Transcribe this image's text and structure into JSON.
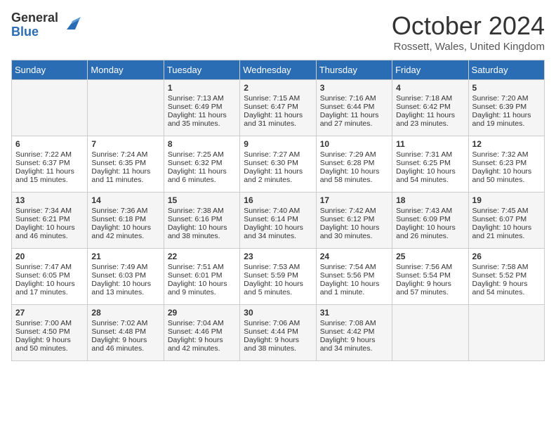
{
  "logo": {
    "general": "General",
    "blue": "Blue"
  },
  "title": "October 2024",
  "subtitle": "Rossett, Wales, United Kingdom",
  "days": [
    "Sunday",
    "Monday",
    "Tuesday",
    "Wednesday",
    "Thursday",
    "Friday",
    "Saturday"
  ],
  "weeks": [
    [
      {
        "day": "",
        "content": ""
      },
      {
        "day": "",
        "content": ""
      },
      {
        "day": "1",
        "content": "Sunrise: 7:13 AM\nSunset: 6:49 PM\nDaylight: 11 hours and 35 minutes."
      },
      {
        "day": "2",
        "content": "Sunrise: 7:15 AM\nSunset: 6:47 PM\nDaylight: 11 hours and 31 minutes."
      },
      {
        "day": "3",
        "content": "Sunrise: 7:16 AM\nSunset: 6:44 PM\nDaylight: 11 hours and 27 minutes."
      },
      {
        "day": "4",
        "content": "Sunrise: 7:18 AM\nSunset: 6:42 PM\nDaylight: 11 hours and 23 minutes."
      },
      {
        "day": "5",
        "content": "Sunrise: 7:20 AM\nSunset: 6:39 PM\nDaylight: 11 hours and 19 minutes."
      }
    ],
    [
      {
        "day": "6",
        "content": "Sunrise: 7:22 AM\nSunset: 6:37 PM\nDaylight: 11 hours and 15 minutes."
      },
      {
        "day": "7",
        "content": "Sunrise: 7:24 AM\nSunset: 6:35 PM\nDaylight: 11 hours and 11 minutes."
      },
      {
        "day": "8",
        "content": "Sunrise: 7:25 AM\nSunset: 6:32 PM\nDaylight: 11 hours and 6 minutes."
      },
      {
        "day": "9",
        "content": "Sunrise: 7:27 AM\nSunset: 6:30 PM\nDaylight: 11 hours and 2 minutes."
      },
      {
        "day": "10",
        "content": "Sunrise: 7:29 AM\nSunset: 6:28 PM\nDaylight: 10 hours and 58 minutes."
      },
      {
        "day": "11",
        "content": "Sunrise: 7:31 AM\nSunset: 6:25 PM\nDaylight: 10 hours and 54 minutes."
      },
      {
        "day": "12",
        "content": "Sunrise: 7:32 AM\nSunset: 6:23 PM\nDaylight: 10 hours and 50 minutes."
      }
    ],
    [
      {
        "day": "13",
        "content": "Sunrise: 7:34 AM\nSunset: 6:21 PM\nDaylight: 10 hours and 46 minutes."
      },
      {
        "day": "14",
        "content": "Sunrise: 7:36 AM\nSunset: 6:18 PM\nDaylight: 10 hours and 42 minutes."
      },
      {
        "day": "15",
        "content": "Sunrise: 7:38 AM\nSunset: 6:16 PM\nDaylight: 10 hours and 38 minutes."
      },
      {
        "day": "16",
        "content": "Sunrise: 7:40 AM\nSunset: 6:14 PM\nDaylight: 10 hours and 34 minutes."
      },
      {
        "day": "17",
        "content": "Sunrise: 7:42 AM\nSunset: 6:12 PM\nDaylight: 10 hours and 30 minutes."
      },
      {
        "day": "18",
        "content": "Sunrise: 7:43 AM\nSunset: 6:09 PM\nDaylight: 10 hours and 26 minutes."
      },
      {
        "day": "19",
        "content": "Sunrise: 7:45 AM\nSunset: 6:07 PM\nDaylight: 10 hours and 21 minutes."
      }
    ],
    [
      {
        "day": "20",
        "content": "Sunrise: 7:47 AM\nSunset: 6:05 PM\nDaylight: 10 hours and 17 minutes."
      },
      {
        "day": "21",
        "content": "Sunrise: 7:49 AM\nSunset: 6:03 PM\nDaylight: 10 hours and 13 minutes."
      },
      {
        "day": "22",
        "content": "Sunrise: 7:51 AM\nSunset: 6:01 PM\nDaylight: 10 hours and 9 minutes."
      },
      {
        "day": "23",
        "content": "Sunrise: 7:53 AM\nSunset: 5:59 PM\nDaylight: 10 hours and 5 minutes."
      },
      {
        "day": "24",
        "content": "Sunrise: 7:54 AM\nSunset: 5:56 PM\nDaylight: 10 hours and 1 minute."
      },
      {
        "day": "25",
        "content": "Sunrise: 7:56 AM\nSunset: 5:54 PM\nDaylight: 9 hours and 57 minutes."
      },
      {
        "day": "26",
        "content": "Sunrise: 7:58 AM\nSunset: 5:52 PM\nDaylight: 9 hours and 54 minutes."
      }
    ],
    [
      {
        "day": "27",
        "content": "Sunrise: 7:00 AM\nSunset: 4:50 PM\nDaylight: 9 hours and 50 minutes."
      },
      {
        "day": "28",
        "content": "Sunrise: 7:02 AM\nSunset: 4:48 PM\nDaylight: 9 hours and 46 minutes."
      },
      {
        "day": "29",
        "content": "Sunrise: 7:04 AM\nSunset: 4:46 PM\nDaylight: 9 hours and 42 minutes."
      },
      {
        "day": "30",
        "content": "Sunrise: 7:06 AM\nSunset: 4:44 PM\nDaylight: 9 hours and 38 minutes."
      },
      {
        "day": "31",
        "content": "Sunrise: 7:08 AM\nSunset: 4:42 PM\nDaylight: 9 hours and 34 minutes."
      },
      {
        "day": "",
        "content": ""
      },
      {
        "day": "",
        "content": ""
      }
    ]
  ]
}
